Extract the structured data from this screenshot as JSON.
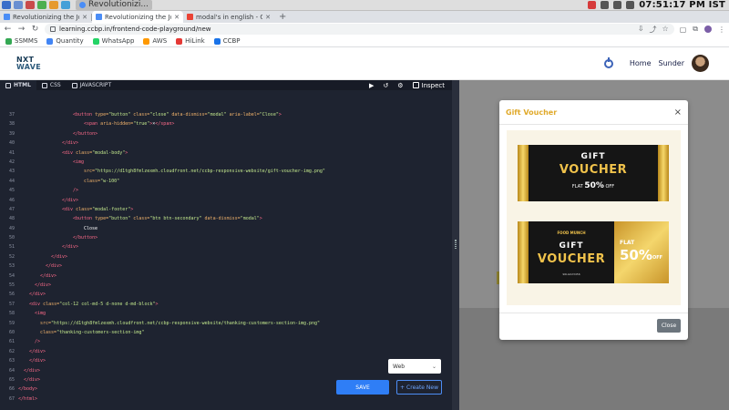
{
  "os": {
    "active_window": "Revolutionizi...",
    "clock": "07:51:17 PM IST",
    "colors": {
      "bar": "#dedede"
    }
  },
  "browser": {
    "tabs": [
      {
        "title": "Revolutionizing the Job M",
        "favicon_color": "#4a8df6"
      },
      {
        "title": "Revolutionizing the Job M",
        "favicon_color": "#4a8df6",
        "active": true
      },
      {
        "title": "modal's in english - Goog",
        "favicon_color": "#ea4335"
      }
    ],
    "new_tab": "+",
    "url": "learning.ccbp.in/frontend-code-playground/new",
    "bookmarks": [
      {
        "label": "SSMMS",
        "icon_color": "#34a853"
      },
      {
        "label": "Quantity",
        "icon_color": "#4285f4"
      },
      {
        "label": "WhatsApp",
        "icon_color": "#25d366"
      },
      {
        "label": "AWS",
        "icon_color": "#ff9900"
      },
      {
        "label": "HiLink",
        "icon_color": "#e53935"
      },
      {
        "label": "CCBP",
        "icon_color": "#1a73e8"
      }
    ]
  },
  "site": {
    "brand_line1": "NXT",
    "brand_line2": "WAVE",
    "nav_home": "Home",
    "user_name": "Sunder"
  },
  "editor": {
    "tabs": [
      "HTML",
      "CSS",
      "JAVASCRIPT"
    ],
    "inspect": "Inspect",
    "lines": [
      {
        "n": "37",
        "indent": 10,
        "parts": [
          [
            "tag",
            "<button "
          ],
          [
            "attr",
            "type="
          ],
          [
            "str",
            "\"button\""
          ],
          [
            "attr",
            " class="
          ],
          [
            "str",
            "\"close\""
          ],
          [
            "attr",
            " data-dismiss="
          ],
          [
            "str",
            "\"modal\""
          ],
          [
            "attr",
            " aria-label="
          ],
          [
            "str",
            "\"Close\""
          ],
          [
            "tag",
            ">"
          ]
        ]
      },
      {
        "n": "38",
        "indent": 12,
        "parts": [
          [
            "tag",
            "<span "
          ],
          [
            "attr",
            "aria-hidden="
          ],
          [
            "str",
            "\"true\""
          ],
          [
            "tag",
            ">"
          ],
          [
            "txt",
            "&times;"
          ],
          [
            "tag",
            "</span>"
          ]
        ]
      },
      {
        "n": "39",
        "indent": 10,
        "parts": [
          [
            "tag",
            "</button>"
          ]
        ]
      },
      {
        "n": "40",
        "indent": 8,
        "parts": [
          [
            "tag",
            "</div>"
          ]
        ]
      },
      {
        "n": "41",
        "indent": 8,
        "parts": [
          [
            "tag",
            "<div "
          ],
          [
            "attr",
            "class="
          ],
          [
            "str",
            "\"modal-body\""
          ],
          [
            "tag",
            ">"
          ]
        ]
      },
      {
        "n": "42",
        "indent": 10,
        "parts": [
          [
            "tag",
            "<img"
          ]
        ]
      },
      {
        "n": "43",
        "indent": 12,
        "parts": [
          [
            "attr",
            "src="
          ],
          [
            "str",
            "\"https://d1tgh8fmlzexmh.cloudfront.net/ccbp-responsive-website/gift-voucher-img.png\""
          ]
        ]
      },
      {
        "n": "44",
        "indent": 12,
        "parts": [
          [
            "attr",
            "class="
          ],
          [
            "str",
            "\"w-100\""
          ]
        ]
      },
      {
        "n": "45",
        "indent": 10,
        "parts": [
          [
            "tag",
            "/>"
          ]
        ]
      },
      {
        "n": "46",
        "indent": 8,
        "parts": [
          [
            "tag",
            "</div>"
          ]
        ]
      },
      {
        "n": "47",
        "indent": 8,
        "parts": [
          [
            "tag",
            "<div "
          ],
          [
            "attr",
            "class="
          ],
          [
            "str",
            "\"modal-footer\""
          ],
          [
            "tag",
            ">"
          ]
        ]
      },
      {
        "n": "48",
        "indent": 10,
        "parts": [
          [
            "tag",
            "<button "
          ],
          [
            "attr",
            "type="
          ],
          [
            "str",
            "\"button\""
          ],
          [
            "attr",
            " class="
          ],
          [
            "str",
            "\"btn btn-secondary\""
          ],
          [
            "attr",
            " data-dismiss="
          ],
          [
            "str",
            "\"modal\""
          ],
          [
            "tag",
            ">"
          ]
        ]
      },
      {
        "n": "49",
        "indent": 12,
        "parts": [
          [
            "txt",
            "Close"
          ]
        ]
      },
      {
        "n": "50",
        "indent": 10,
        "parts": [
          [
            "tag",
            "</button>"
          ]
        ]
      },
      {
        "n": "51",
        "indent": 8,
        "parts": [
          [
            "tag",
            "</div>"
          ]
        ]
      },
      {
        "n": "52",
        "indent": 6,
        "parts": [
          [
            "tag",
            "</div>"
          ]
        ]
      },
      {
        "n": "53",
        "indent": 5,
        "parts": [
          [
            "tag",
            "</div>"
          ]
        ]
      },
      {
        "n": "54",
        "indent": 4,
        "parts": [
          [
            "tag",
            "</div>"
          ]
        ]
      },
      {
        "n": "55",
        "indent": 3,
        "parts": [
          [
            "tag",
            "</div>"
          ]
        ]
      },
      {
        "n": "56",
        "indent": 2,
        "parts": [
          [
            "tag",
            "</div>"
          ]
        ]
      },
      {
        "n": "57",
        "indent": 2,
        "parts": [
          [
            "tag",
            "<div "
          ],
          [
            "attr",
            "class="
          ],
          [
            "str",
            "\"col-12 col-md-5 d-none d-md-block\""
          ],
          [
            "tag",
            ">"
          ]
        ]
      },
      {
        "n": "58",
        "indent": 3,
        "parts": [
          [
            "tag",
            "<img"
          ]
        ]
      },
      {
        "n": "59",
        "indent": 4,
        "parts": [
          [
            "attr",
            "src="
          ],
          [
            "str",
            "\"https://d1tgh8fmlzexmh.cloudfront.net/ccbp-responsive-website/thanking-customers-section-img.png\""
          ]
        ]
      },
      {
        "n": "60",
        "indent": 4,
        "parts": [
          [
            "attr",
            "class="
          ],
          [
            "str",
            "\"thanking-customers-section-img\""
          ]
        ]
      },
      {
        "n": "61",
        "indent": 3,
        "parts": [
          [
            "tag",
            "/>"
          ]
        ]
      },
      {
        "n": "62",
        "indent": 2,
        "parts": [
          [
            "tag",
            "</div>"
          ]
        ]
      },
      {
        "n": "63",
        "indent": 2,
        "parts": [
          [
            "tag",
            "</div>"
          ]
        ]
      },
      {
        "n": "64",
        "indent": 1,
        "parts": [
          [
            "tag",
            "</div>"
          ]
        ]
      },
      {
        "n": "65",
        "indent": 1,
        "parts": [
          [
            "tag",
            "</div>"
          ]
        ]
      },
      {
        "n": "66",
        "indent": 0,
        "parts": [
          [
            "tag",
            "</body>"
          ]
        ]
      },
      {
        "n": "67",
        "indent": 0,
        "parts": [
          [
            "tag",
            "</html>"
          ]
        ]
      }
    ],
    "mode_select": "Web",
    "save_label": "SAVE",
    "create_new_label": "Create New"
  },
  "modal": {
    "title": "Gift Voucher",
    "close_x": "×",
    "close_button": "Close",
    "voucher1": {
      "gift": "GIFT",
      "voucher": "VOUCHER",
      "flat": "FLAT",
      "pct": "50%",
      "off": "OFF"
    },
    "voucher2": {
      "brand": "FOOD MUNCH",
      "gift": "GIFT",
      "voucher": "VOUCHER",
      "code": "96LG023456",
      "flat": "FLAT",
      "pct": "50%",
      "off": "OFF"
    }
  }
}
